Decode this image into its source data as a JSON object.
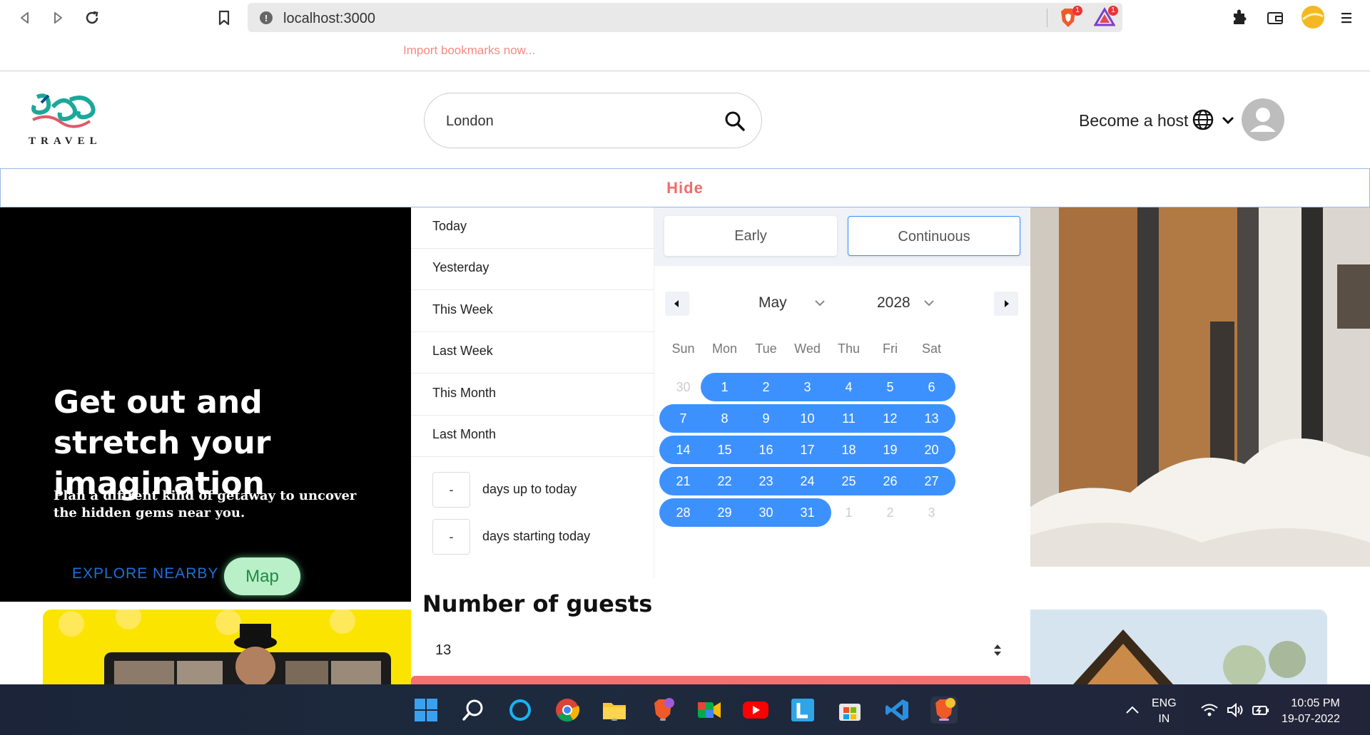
{
  "browser": {
    "url": "localhost:3000",
    "bookmarks_prompt": "Import bookmarks now...",
    "brave_badge": "1",
    "rewards_badge": "1"
  },
  "header": {
    "search_value": "London",
    "become_host": "Become a host",
    "logo_word": "TRAVEL"
  },
  "hide_label": "Hide",
  "hero": {
    "title": "Get out and stretch your imagination",
    "subtitle": "Plan a diffrent kind of getaway to uncover the hidden gems near you.",
    "explore_label": "EXPLORE NEARBY",
    "map_label": "Map"
  },
  "datepicker": {
    "presets": [
      "Today",
      "Yesterday",
      "This Week",
      "Last Week",
      "This Month",
      "Last Month"
    ],
    "range_inputs": [
      {
        "value": "-",
        "label": "days up to today"
      },
      {
        "value": "-",
        "label": "days starting today"
      }
    ],
    "modes": [
      "Early",
      "Continuous"
    ],
    "active_mode": "Continuous",
    "month": "May",
    "year": "2028",
    "weekdays": [
      "Sun",
      "Mon",
      "Tue",
      "Wed",
      "Thu",
      "Fri",
      "Sat"
    ],
    "weeks": [
      [
        "30",
        "1",
        "2",
        "3",
        "4",
        "5",
        "6"
      ],
      [
        "7",
        "8",
        "9",
        "10",
        "11",
        "12",
        "13"
      ],
      [
        "14",
        "15",
        "16",
        "17",
        "18",
        "19",
        "20"
      ],
      [
        "21",
        "22",
        "23",
        "24",
        "25",
        "26",
        "27"
      ],
      [
        "28",
        "29",
        "30",
        "31",
        "1",
        "2",
        "3"
      ]
    ],
    "accent_color": "#3d91ff"
  },
  "guests": {
    "title": "Number of guests",
    "value": "13"
  },
  "taskbar": {
    "lang_line1": "ENG",
    "lang_line2": "IN",
    "time": "10:05 PM",
    "date": "19-07-2022"
  }
}
